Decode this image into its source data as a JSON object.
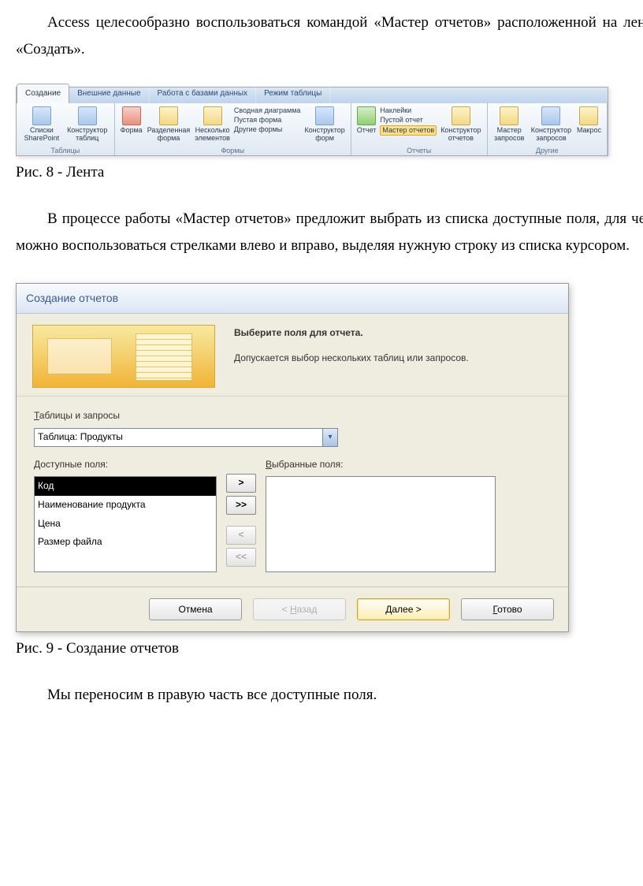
{
  "p1": "Access целесообразно воспользоваться командой «Мастер отчетов» расположенной на ленте «Создать».",
  "fig8": "Рис. 8 - Лента",
  "p2": "В процессе работы «Мастер отчетов» предложит выбрать из списка доступные поля, для чего можно воспользоваться стрелками влево и вправо, выделяя нужную строку из списка курсором.",
  "fig9": "Рис. 9 - Создание отчетов",
  "p3": "Мы переносим в правую часть все доступные поля.",
  "ribbon": {
    "tabs": [
      "Создание",
      "Внешние данные",
      "Работа с базами данных",
      "Режим таблицы"
    ],
    "groups": {
      "g1": {
        "label": "Таблицы",
        "items": [
          "Списки SharePoint",
          "Конструктор таблиц"
        ]
      },
      "g2": {
        "label": "Формы",
        "items": [
          "Форма",
          "Разделенная форма",
          "Несколько элементов"
        ],
        "small": [
          "Сводная диаграмма",
          "Пустая форма",
          "Другие формы"
        ],
        "after": "Конструктор форм"
      },
      "g3": {
        "label": "Отчеты",
        "item": "Отчет",
        "small": [
          "Наклейки",
          "Пустой отчет",
          "Мастер отчетов"
        ],
        "after": "Конструктор отчетов"
      },
      "g4": {
        "label": "Другие",
        "items": [
          "Мастер запросов",
          "Конструктор запросов",
          "Макрос"
        ]
      }
    }
  },
  "wizard": {
    "title": "Создание отчетов",
    "heading": "Выберите поля для отчета.",
    "sub": "Допускается выбор нескольких таблиц или запросов.",
    "tables_label_u": "Т",
    "tables_label_rest": "аблицы и запросы",
    "combo_value": "Таблица: Продукты",
    "avail_label": "Доступные поля:",
    "sel_label_u": "В",
    "sel_label_rest": "ыбранные поля:",
    "available": [
      "Код",
      "Наименование продукта",
      "Цена",
      "Размер файла"
    ],
    "btn_add": ">",
    "btn_addall": ">>",
    "btn_rem": "<",
    "btn_remall": "<<",
    "cancel": "Отмена",
    "back": "< Назад",
    "next": "Далее >",
    "finish": "Готово"
  }
}
